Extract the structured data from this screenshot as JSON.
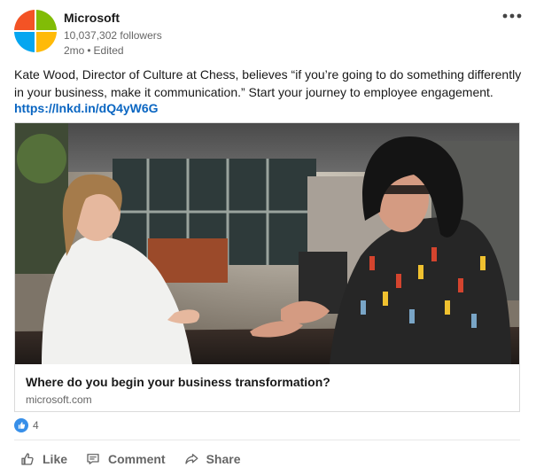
{
  "post": {
    "company": "Microsoft",
    "followers": "10,037,302 followers",
    "time": "2mo",
    "separator": "•",
    "edited": "Edited",
    "text": "Kate Wood, Director of Culture at Chess, believes “if you’re going to do something differently in your business, make it communication.” Start your journey to employee engagement.",
    "link": "https://lnkd.in/dQ4yW6G"
  },
  "media": {
    "title": "Where do you begin your business transformation?",
    "source": "microsoft.com"
  },
  "reactions": {
    "count": "4",
    "icon": "thumbs-up-icon"
  },
  "actions": {
    "like": "Like",
    "comment": "Comment",
    "share": "Share"
  },
  "colors": {
    "link": "#0a66c2",
    "reaction_badge": "#378fe9",
    "ms_red": "#f35325",
    "ms_green": "#81bc06",
    "ms_blue": "#05a6f0",
    "ms_yellow": "#ffba08"
  }
}
